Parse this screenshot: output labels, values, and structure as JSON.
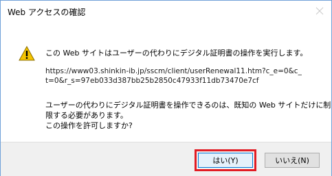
{
  "window": {
    "title": "Web アクセスの確認"
  },
  "message": {
    "main": "この Web サイトはユーザーの代わりにデジタル証明書の操作を実行します。",
    "url_line1": "https://www03.shinkin-ib.jp/sscm/client/userRenewal11.htm?c_e=0&c_",
    "url_line2": "t=0&r_s=97eb033d387bb25b2850c47933f11db73470e7cf",
    "note_line1": "ユーザーの代わりにデジタル証明書を操作できるのは、既知の Web サイトだけに制",
    "note_line2": "限する必要があります。",
    "note_line3": "この操作を許可しますか?"
  },
  "buttons": {
    "yes_label": "はい(Y)",
    "no_label": "いいえ(N)"
  },
  "icons": {
    "warning": "warning-icon",
    "close": "close-icon"
  },
  "colors": {
    "highlight": "#e21b23",
    "default_button_border": "#0078d7",
    "warning_fill": "#f5c400"
  }
}
